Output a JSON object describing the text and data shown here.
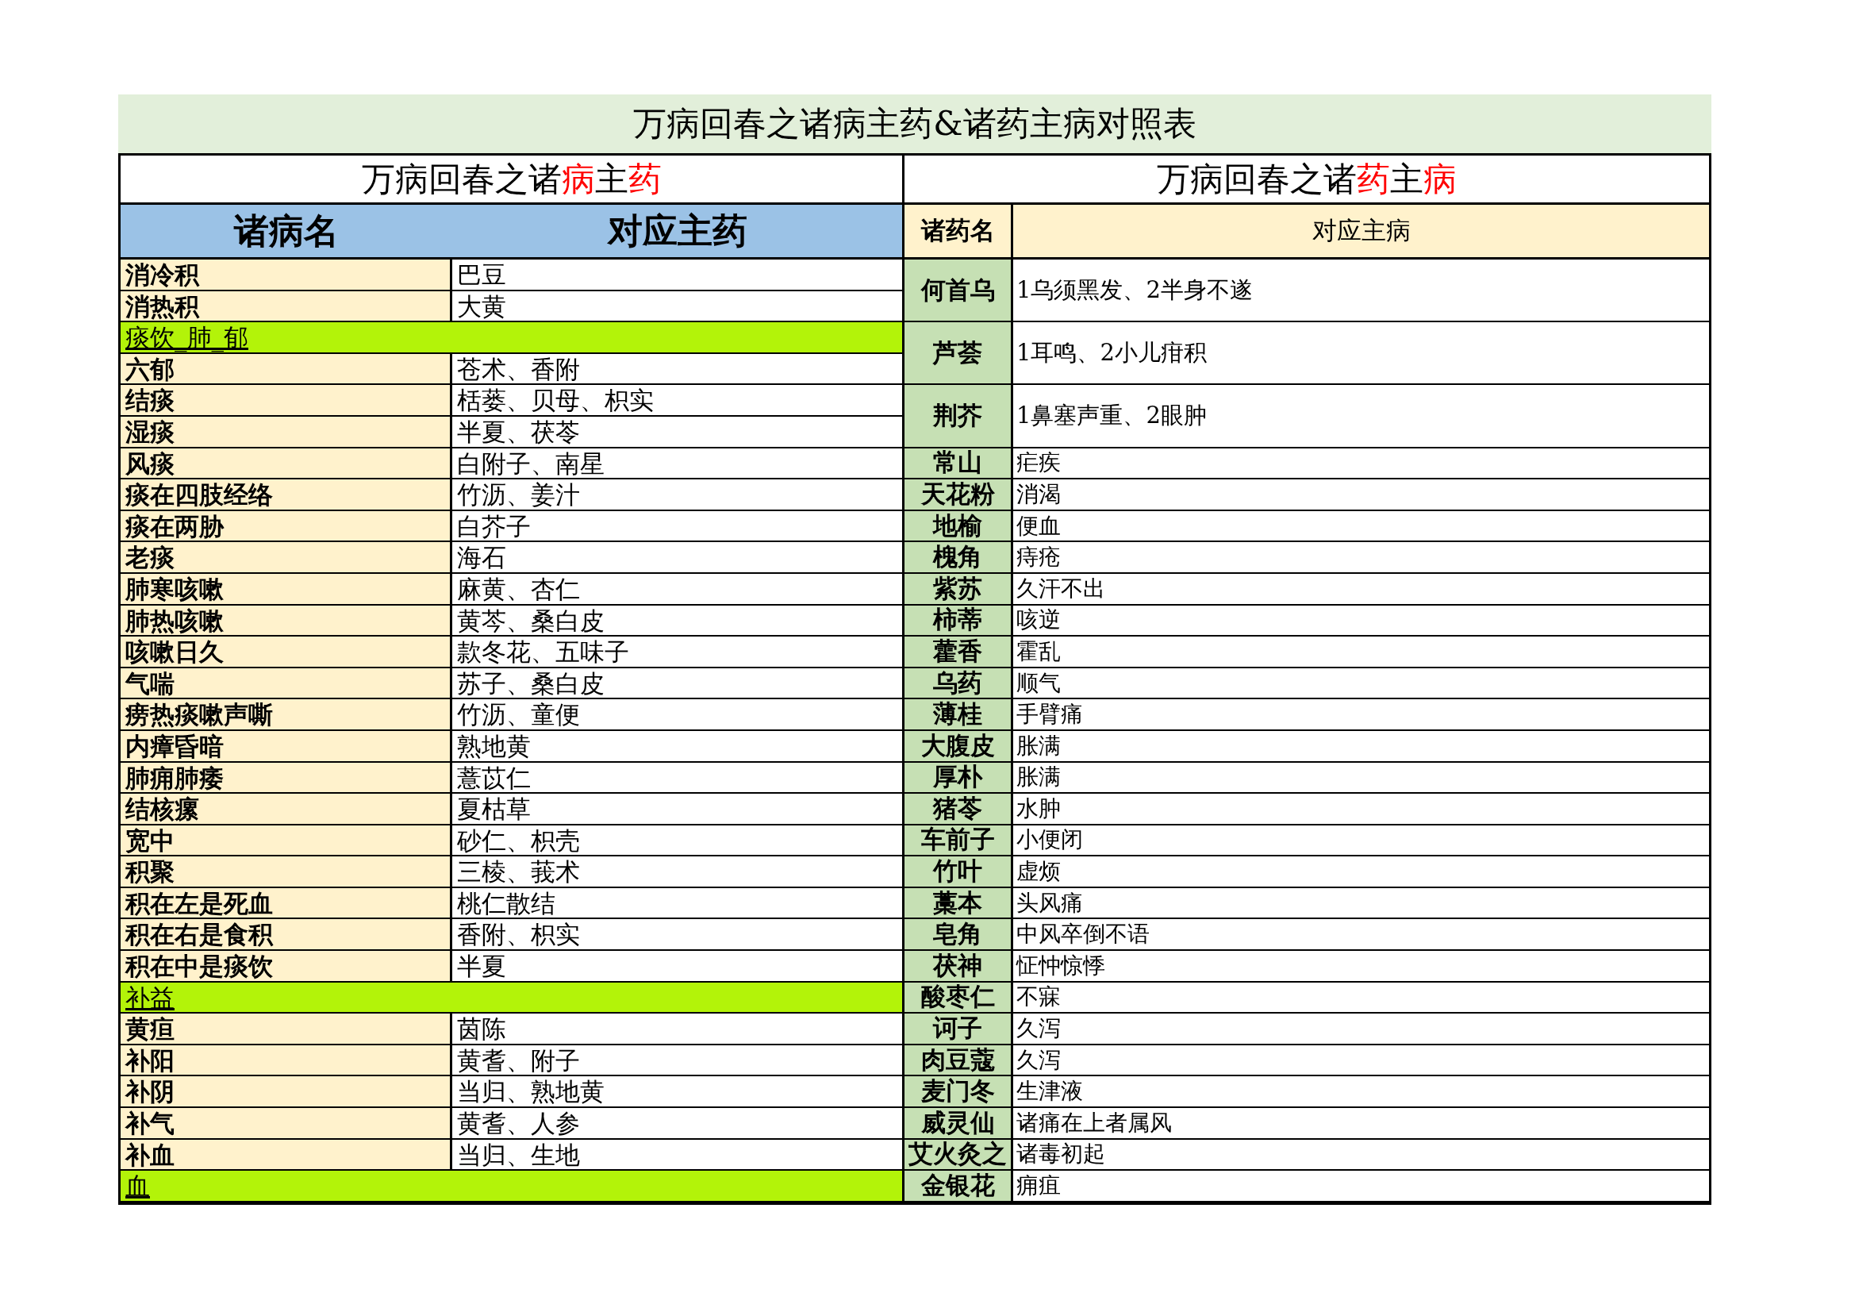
{
  "title": "万病回春之诸病主药&诸药主病对照表",
  "left": {
    "heading": [
      {
        "text": "万病回春之诸",
        "highlight": false
      },
      {
        "text": "病",
        "highlight": true
      },
      {
        "text": "主",
        "highlight": false
      },
      {
        "text": "药",
        "highlight": true
      }
    ],
    "columns": [
      "诸病名",
      "对应主药"
    ],
    "rows": [
      {
        "kind": "item",
        "name": "消冷积",
        "value": "巴豆"
      },
      {
        "kind": "item",
        "name": "消热积",
        "value": "大黄"
      },
      {
        "kind": "section",
        "name": "痰饮_肺_郁"
      },
      {
        "kind": "item",
        "name": "六郁",
        "value": "苍术、香附"
      },
      {
        "kind": "item",
        "name": "结痰",
        "value": "栝蒌、贝母、枳实"
      },
      {
        "kind": "item",
        "name": "湿痰",
        "value": "半夏、茯苓"
      },
      {
        "kind": "item",
        "name": "风痰",
        "value": "白附子、南星"
      },
      {
        "kind": "item",
        "name": "痰在四肢经络",
        "value": "竹沥、姜汁"
      },
      {
        "kind": "item",
        "name": "痰在两胁",
        "value": "白芥子"
      },
      {
        "kind": "item",
        "name": "老痰",
        "value": "海石"
      },
      {
        "kind": "item",
        "name": "肺寒咳嗽",
        "value": "麻黄、杏仁"
      },
      {
        "kind": "item",
        "name": "肺热咳嗽",
        "value": "黄芩、桑白皮"
      },
      {
        "kind": "item",
        "name": "咳嗽日久",
        "value": "款冬花、五味子"
      },
      {
        "kind": "item",
        "name": "气喘",
        "value": "苏子、桑白皮"
      },
      {
        "kind": "item",
        "name": "痨热痰嗽声嘶",
        "value": "竹沥、童便"
      },
      {
        "kind": "item",
        "name": "内瘴昏暗",
        "value": "熟地黄"
      },
      {
        "kind": "item",
        "name": "肺痈肺痿",
        "value": "薏苡仁"
      },
      {
        "kind": "item",
        "name": "结核瘰",
        "value": "夏枯草"
      },
      {
        "kind": "item",
        "name": "宽中",
        "value": "砂仁、枳壳"
      },
      {
        "kind": "item",
        "name": "积聚",
        "value": "三棱、莪术"
      },
      {
        "kind": "item",
        "name": "积在左是死血",
        "value": "桃仁散结"
      },
      {
        "kind": "item",
        "name": "积在右是食积",
        "value": "香附、枳实"
      },
      {
        "kind": "item",
        "name": "积在中是痰饮",
        "value": "半夏"
      },
      {
        "kind": "section",
        "name": "补益"
      },
      {
        "kind": "item",
        "name": "黄疸",
        "value": "茵陈"
      },
      {
        "kind": "item",
        "name": "补阳",
        "value": "黄耆、附子"
      },
      {
        "kind": "item",
        "name": "补阴",
        "value": "当归、熟地黄"
      },
      {
        "kind": "item",
        "name": "补气",
        "value": "黄耆、人参"
      },
      {
        "kind": "item",
        "name": "补血",
        "value": "当归、生地"
      },
      {
        "kind": "section",
        "name": "血"
      }
    ]
  },
  "right": {
    "heading": [
      {
        "text": "万病回春之诸",
        "highlight": false
      },
      {
        "text": "药",
        "highlight": true
      },
      {
        "text": "主",
        "highlight": false
      },
      {
        "text": "病",
        "highlight": true
      }
    ],
    "columns": [
      "诸药名",
      "对应主病"
    ],
    "rows": [
      {
        "name": "何首乌",
        "value": "1乌须黑发、2半身不遂",
        "tall": true
      },
      {
        "name": "芦荟",
        "value": "1耳鸣、2小儿疳积",
        "tall": true
      },
      {
        "name": "荆芥",
        "value": "1鼻塞声重、2眼肿",
        "tall": true
      },
      {
        "name": "常山",
        "value": "疟疾",
        "tall": false
      },
      {
        "name": "天花粉",
        "value": "消渴",
        "tall": false
      },
      {
        "name": "地榆",
        "value": "便血",
        "tall": false
      },
      {
        "name": "槐角",
        "value": "痔疮",
        "tall": false
      },
      {
        "name": "紫苏",
        "value": "久汗不出",
        "tall": false
      },
      {
        "name": "柿蒂",
        "value": "咳逆",
        "tall": false
      },
      {
        "name": "藿香",
        "value": "霍乱",
        "tall": false
      },
      {
        "name": "乌药",
        "value": "顺气",
        "tall": false
      },
      {
        "name": "薄桂",
        "value": "手臂痛",
        "tall": false
      },
      {
        "name": "大腹皮",
        "value": "胀满",
        "tall": false
      },
      {
        "name": "厚朴",
        "value": "胀满",
        "tall": false
      },
      {
        "name": "猪苓",
        "value": "水肿",
        "tall": false
      },
      {
        "name": "车前子",
        "value": "小便闭",
        "tall": false
      },
      {
        "name": "竹叶",
        "value": "虚烦",
        "tall": false
      },
      {
        "name": "藁本",
        "value": "头风痛",
        "tall": false
      },
      {
        "name": "皂角",
        "value": "中风卒倒不语",
        "tall": false
      },
      {
        "name": "茯神",
        "value": "怔忡惊悸",
        "tall": false
      },
      {
        "name": "酸枣仁",
        "value": "不寐",
        "tall": false
      },
      {
        "name": "诃子",
        "value": "久泻",
        "tall": false
      },
      {
        "name": "肉豆蔻",
        "value": "久泻",
        "tall": false
      },
      {
        "name": "麦门冬",
        "value": "生津液",
        "tall": false
      },
      {
        "name": "威灵仙",
        "value": "诸痛在上者属风",
        "tall": false
      },
      {
        "name": "艾火灸之",
        "value": "诸毒初起",
        "tall": false
      },
      {
        "name": "金银花",
        "value": "痈疽",
        "tall": false
      }
    ]
  }
}
